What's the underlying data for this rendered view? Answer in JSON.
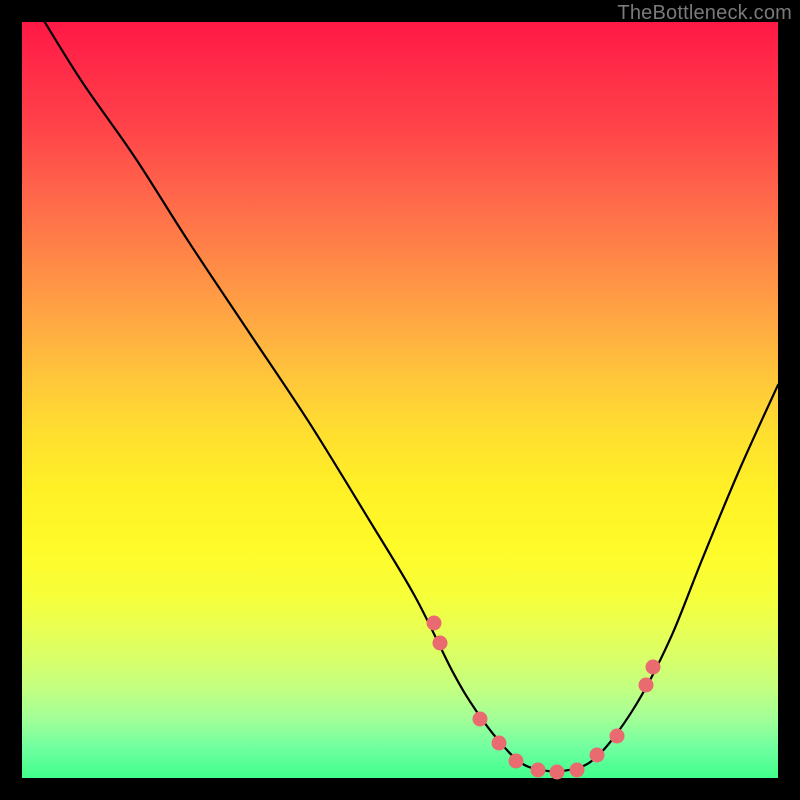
{
  "watermark": "TheBottleneck.com",
  "chart_data": {
    "type": "line",
    "title": "",
    "xlabel": "",
    "ylabel": "",
    "xlim": [
      0,
      100
    ],
    "ylim": [
      0,
      100
    ],
    "grid": false,
    "legend": false,
    "series": [
      {
        "name": "curve",
        "x": [
          3,
          8,
          15,
          22,
          30,
          38,
          46,
          52,
          57,
          60,
          63,
          66,
          69,
          72,
          75,
          78,
          82,
          86,
          90,
          95,
          100
        ],
        "y": [
          100,
          92,
          82,
          71,
          59,
          47,
          34,
          24,
          14,
          9,
          5,
          2,
          1,
          1,
          2,
          5,
          11,
          19,
          29,
          41,
          52
        ]
      },
      {
        "name": "points",
        "x": [
          54.5,
          55.3,
          60.6,
          63.1,
          65.3,
          68.3,
          70.8,
          73.4,
          76.0,
          78.7,
          82.6,
          83.5
        ],
        "y": [
          20.5,
          17.9,
          7.8,
          4.6,
          2.2,
          1.0,
          0.8,
          1.0,
          3.0,
          5.6,
          12.3,
          14.7
        ]
      }
    ]
  }
}
